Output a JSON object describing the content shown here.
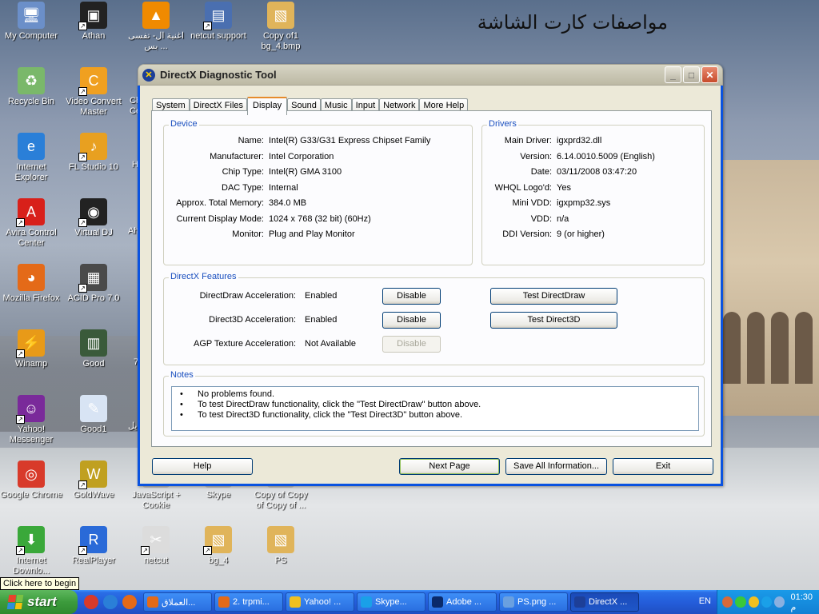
{
  "desktop": {
    "arabic_title": "مواصفات كارت الشاشة",
    "tooltip": "Click here to begin",
    "icons": [
      {
        "label": "My Computer",
        "icon": "computer-icon",
        "color": "#6b8fc9",
        "glyph": "🖥",
        "shortcut": false
      },
      {
        "label": "Athan",
        "icon": "kaaba-icon",
        "color": "#222222",
        "glyph": "▣",
        "shortcut": true
      },
      {
        "label": "اغنية ال- تفسى بس ...",
        "icon": "vlc-icon",
        "color": "#f08a00",
        "glyph": "▲",
        "shortcut": false
      },
      {
        "label": "netcut support",
        "icon": "document-icon",
        "color": "#4a6fb0",
        "glyph": "▤",
        "shortcut": true
      },
      {
        "label": "Copy of1 bg_4.bmp",
        "icon": "image-icon",
        "color": "#e0b45a",
        "glyph": "▧",
        "shortcut": false
      },
      {
        "label": "Recycle Bin",
        "icon": "recycle-bin-icon",
        "color": "#7ab86a",
        "glyph": "♻",
        "shortcut": false
      },
      {
        "label": "Video Convert Master",
        "icon": "video-convert-icon",
        "color": "#f0a020",
        "glyph": "C",
        "shortcut": true
      },
      {
        "label": "Internet Explorer",
        "icon": "internet-explorer-icon",
        "color": "#2a7fd8",
        "glyph": "e",
        "shortcut": false
      },
      {
        "label": "FL Studio 10",
        "icon": "fl-studio-icon",
        "color": "#e8a020",
        "glyph": "♪",
        "shortcut": true
      },
      {
        "label": "Avira Control Center",
        "icon": "avira-icon",
        "color": "#d8201a",
        "glyph": "A",
        "shortcut": true
      },
      {
        "label": "Virtual DJ",
        "icon": "virtual-dj-icon",
        "color": "#222222",
        "glyph": "◉",
        "shortcut": true
      },
      {
        "label": "Mozilla Firefox",
        "icon": "firefox-icon",
        "color": "#e46a18",
        "glyph": "◕",
        "shortcut": false
      },
      {
        "label": "ACID Pro 7.0",
        "icon": "acid-pro-icon",
        "color": "#4a4a4a",
        "glyph": "▦",
        "shortcut": true
      },
      {
        "label": "Winamp",
        "icon": "winamp-icon",
        "color": "#e89a18",
        "glyph": "⚡",
        "shortcut": true
      },
      {
        "label": "Good",
        "icon": "archive-icon",
        "color": "#3a5a3a",
        "glyph": "▥",
        "shortcut": false
      },
      {
        "label": "Yahoo! Messenger",
        "icon": "yahoo-messenger-icon",
        "color": "#7a2a9a",
        "glyph": "☺",
        "shortcut": true
      },
      {
        "label": "Good1",
        "icon": "script-file-icon",
        "color": "#d8e4f4",
        "glyph": "✎",
        "shortcut": false
      },
      {
        "label": "Google Chrome",
        "icon": "chrome-icon",
        "color": "#d83a2a",
        "glyph": "◎",
        "shortcut": false
      },
      {
        "label": "GoldWave",
        "icon": "goldwave-icon",
        "color": "#c0a020",
        "glyph": "W",
        "shortcut": true
      },
      {
        "label": "JavaScript + Cookie",
        "icon": "text-file-icon",
        "color": "#c0c0c0",
        "glyph": "",
        "shortcut": false
      },
      {
        "label": "Skype",
        "icon": "skype-file-icon",
        "color": "#c0c0c0",
        "glyph": "",
        "shortcut": false
      },
      {
        "label": "Copy of Copy of Copy of ...",
        "icon": "image-file-icon",
        "color": "#c0c0c0",
        "glyph": "",
        "shortcut": false
      },
      {
        "label": "Internet Downlo...",
        "icon": "idm-icon",
        "color": "#3aa83a",
        "glyph": "⬇",
        "shortcut": true
      },
      {
        "label": "RealPlayer",
        "icon": "realplayer-icon",
        "color": "#2a6ad8",
        "glyph": "R",
        "shortcut": true
      },
      {
        "label": "netcut",
        "icon": "netcut-icon",
        "color": "#dcdcdc",
        "glyph": "✂",
        "shortcut": true
      },
      {
        "label": "bg_4",
        "icon": "bitmap-icon",
        "color": "#e0b45a",
        "glyph": "▧",
        "shortcut": true
      },
      {
        "label": "PS",
        "icon": "ps-image-icon",
        "color": "#e0b45a",
        "glyph": "▧",
        "shortcut": false
      }
    ],
    "partial_labels": [
      "Ch Ce",
      "H",
      "Ah",
      "7",
      "يل"
    ]
  },
  "window": {
    "title": "DirectX Diagnostic Tool",
    "controls": {
      "minimize": "_",
      "maximize": "□",
      "close": "✕"
    },
    "tabs": [
      "System",
      "DirectX Files",
      "Display",
      "Sound",
      "Music",
      "Input",
      "Network",
      "More Help"
    ],
    "active_tab": "Display",
    "device": {
      "legend": "Device",
      "rows": [
        {
          "key": "Name:",
          "value": "Intel(R) G33/G31 Express Chipset Family"
        },
        {
          "key": "Manufacturer:",
          "value": "Intel Corporation"
        },
        {
          "key": "Chip Type:",
          "value": "Intel(R) GMA 3100"
        },
        {
          "key": "DAC Type:",
          "value": "Internal"
        },
        {
          "key": "Approx. Total Memory:",
          "value": "384.0 MB"
        },
        {
          "key": "Current Display Mode:",
          "value": "1024 x 768 (32 bit) (60Hz)"
        },
        {
          "key": "Monitor:",
          "value": "Plug and Play Monitor"
        }
      ]
    },
    "drivers": {
      "legend": "Drivers",
      "rows": [
        {
          "key": "Main Driver:",
          "value": "igxprd32.dll"
        },
        {
          "key": "Version:",
          "value": "6.14.0010.5009 (English)"
        },
        {
          "key": "Date:",
          "value": "03/11/2008 03:47:20"
        },
        {
          "key": "WHQL Logo'd:",
          "value": "Yes"
        },
        {
          "key": "Mini VDD:",
          "value": "igxpmp32.sys"
        },
        {
          "key": "VDD:",
          "value": "n/a"
        },
        {
          "key": "DDI Version:",
          "value": "9 (or higher)"
        }
      ]
    },
    "features": {
      "legend": "DirectX Features",
      "rows": [
        {
          "key": "DirectDraw Acceleration:",
          "value": "Enabled",
          "toggle": "Disable",
          "toggle_enabled": true,
          "test": "Test DirectDraw"
        },
        {
          "key": "Direct3D Acceleration:",
          "value": "Enabled",
          "toggle": "Disable",
          "toggle_enabled": true,
          "test": "Test Direct3D"
        },
        {
          "key": "AGP Texture Acceleration:",
          "value": "Not Available",
          "toggle": "Disable",
          "toggle_enabled": false,
          "test": ""
        }
      ]
    },
    "notes": {
      "legend": "Notes",
      "lines": [
        "No problems found.",
        "To test DirectDraw functionality, click the \"Test DirectDraw\" button above.",
        "To test Direct3D functionality, click the \"Test Direct3D\" button above."
      ]
    },
    "buttons": {
      "help": "Help",
      "next_page": "Next Page",
      "save_all": "Save All Information...",
      "exit": "Exit"
    }
  },
  "taskbar": {
    "start_label": "start",
    "tasks": [
      {
        "label": "العملاق...",
        "icon": "firefox-icon",
        "color": "#e46a18",
        "active": false
      },
      {
        "label": "2. trpmi...",
        "icon": "firefox-icon",
        "color": "#e46a18",
        "active": false
      },
      {
        "label": "Yahoo! ...",
        "icon": "yahoo-messenger-icon",
        "color": "#f0c020",
        "active": false
      },
      {
        "label": "Skype...",
        "icon": "skype-icon",
        "color": "#1aa0e8",
        "active": false
      },
      {
        "label": "Adobe ...",
        "icon": "photoshop-icon",
        "color": "#0a2a6a",
        "active": false
      },
      {
        "label": "PS.png ...",
        "icon": "image-viewer-icon",
        "color": "#6aa0e0",
        "active": false
      },
      {
        "label": "DirectX ...",
        "icon": "directx-icon",
        "color": "#1d3f98",
        "active": true
      }
    ],
    "language": "EN",
    "clock": "01:30 م"
  }
}
